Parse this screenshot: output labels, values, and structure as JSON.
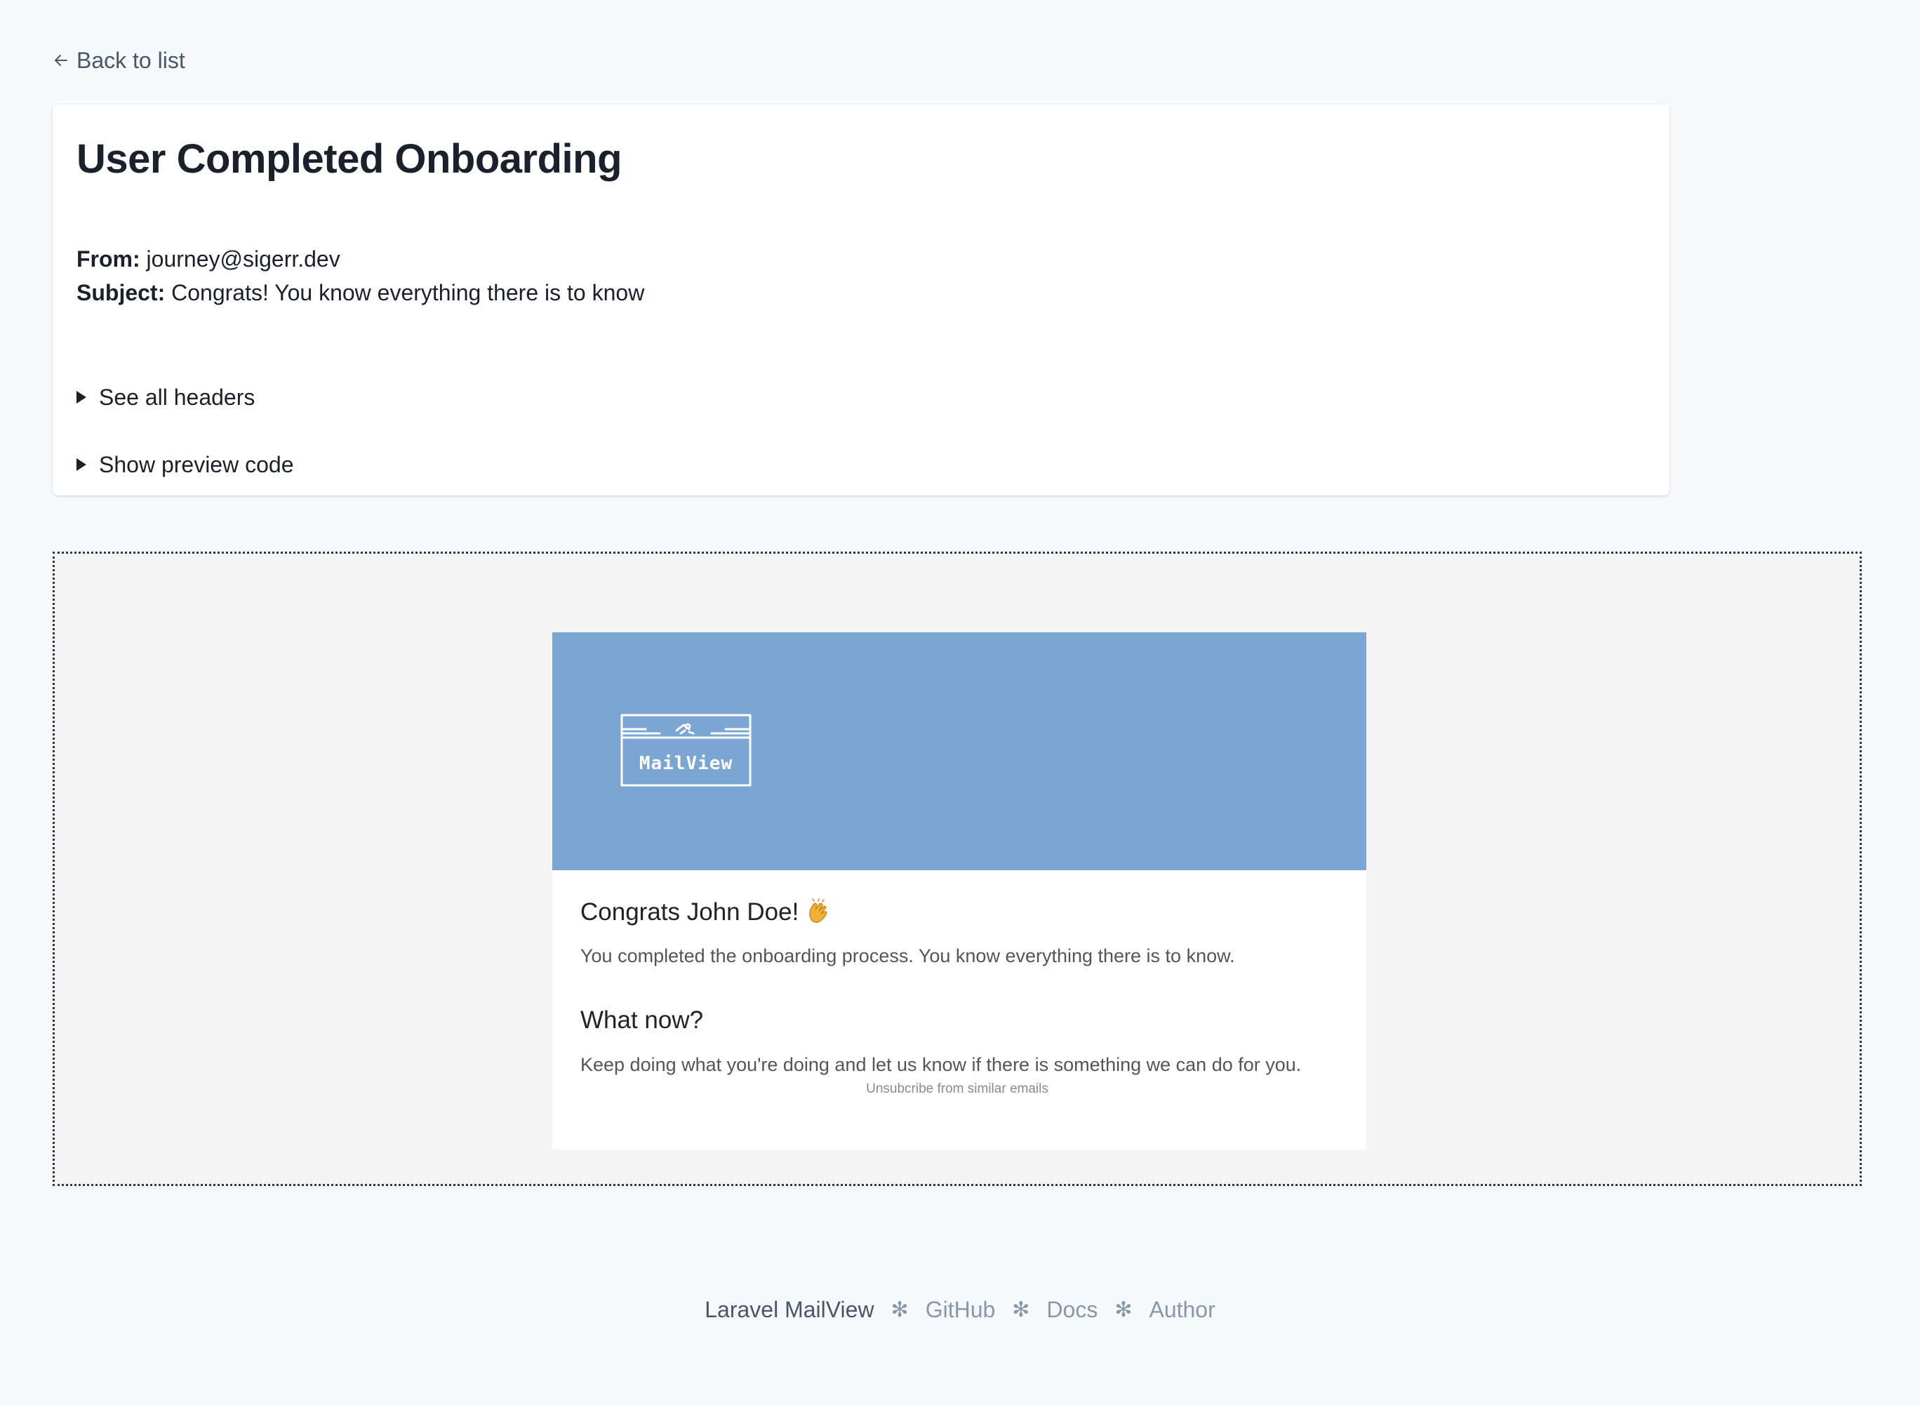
{
  "nav": {
    "back_label": "Back to list"
  },
  "mail": {
    "title": "User Completed Onboarding",
    "from_label": "From:",
    "from_value": "journey@sigerr.dev",
    "subject_label": "Subject:",
    "subject_value": "Congrats! You know everything there is to know",
    "see_headers_label": "See all headers",
    "show_code_label": "Show preview code"
  },
  "email_preview": {
    "logo_text": "MailView",
    "heading": "Congrats John Doe!",
    "paragraph1": "You completed the onboarding process. You know everything there is to know.",
    "subheading": "What now?",
    "paragraph2": "Keep doing what you're doing and let us know if there is something we can do for you.",
    "unsubscribe": "Unsubcribe from similar emails",
    "header_color": "#7ba6d3"
  },
  "footer": {
    "brand": "Laravel MailView",
    "separator": "✻",
    "links": [
      "GitHub",
      "Docs",
      "Author"
    ]
  },
  "icons": {
    "back": "arrow-left-icon",
    "disclosure": "triangle-right-icon",
    "clap": "clapping-hands-icon",
    "logo": "mailview-logo-icon"
  }
}
